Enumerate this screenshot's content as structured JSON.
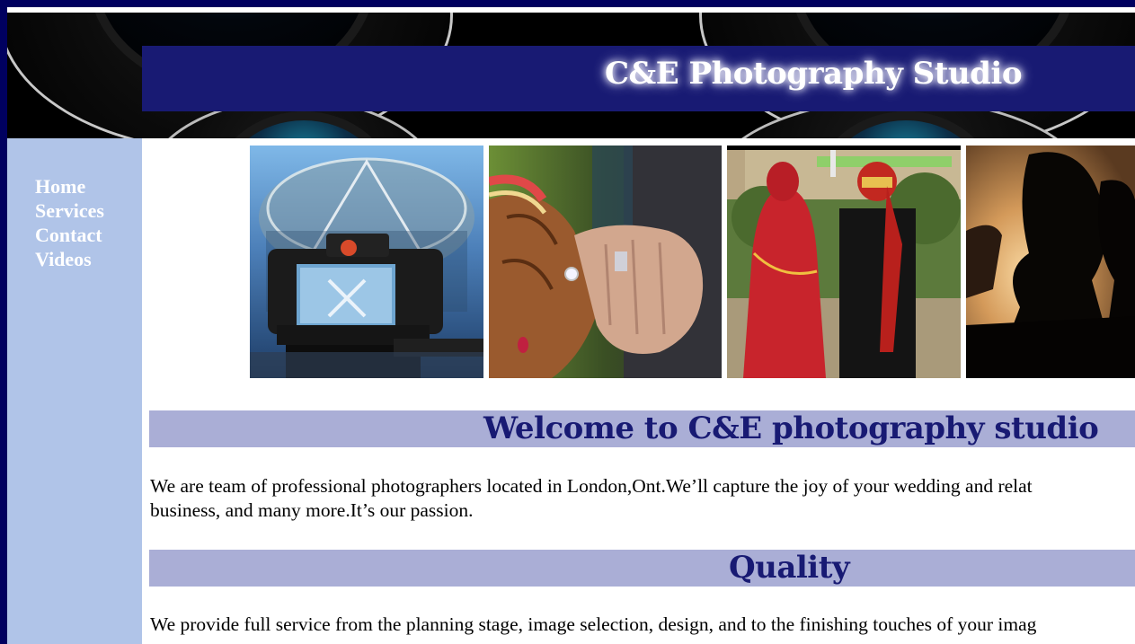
{
  "header": {
    "title": "C&E Photography Studio"
  },
  "sidebar": {
    "items": [
      {
        "label": "Home"
      },
      {
        "label": "Services"
      },
      {
        "label": "Contact"
      },
      {
        "label": "Videos"
      }
    ]
  },
  "colors": {
    "page_frame": "#00005f",
    "title_bar": "#181a73",
    "sidebar_bg": "#b0c4e8",
    "heading_bg": "#aaaed6",
    "heading_text": "#181a73"
  },
  "main": {
    "welcome": {
      "heading": "Welcome to C&E photography studio",
      "lines": [
        "We are team of professional photographers located in London,Ont.We’ll capture the joy of your wedding and relat",
        "business, and many more.It’s our passion."
      ]
    },
    "quality": {
      "heading": "Quality",
      "lines": [
        "We provide full service from the planning stage, image selection, design, and to the finishing touches of your imag"
      ]
    }
  }
}
